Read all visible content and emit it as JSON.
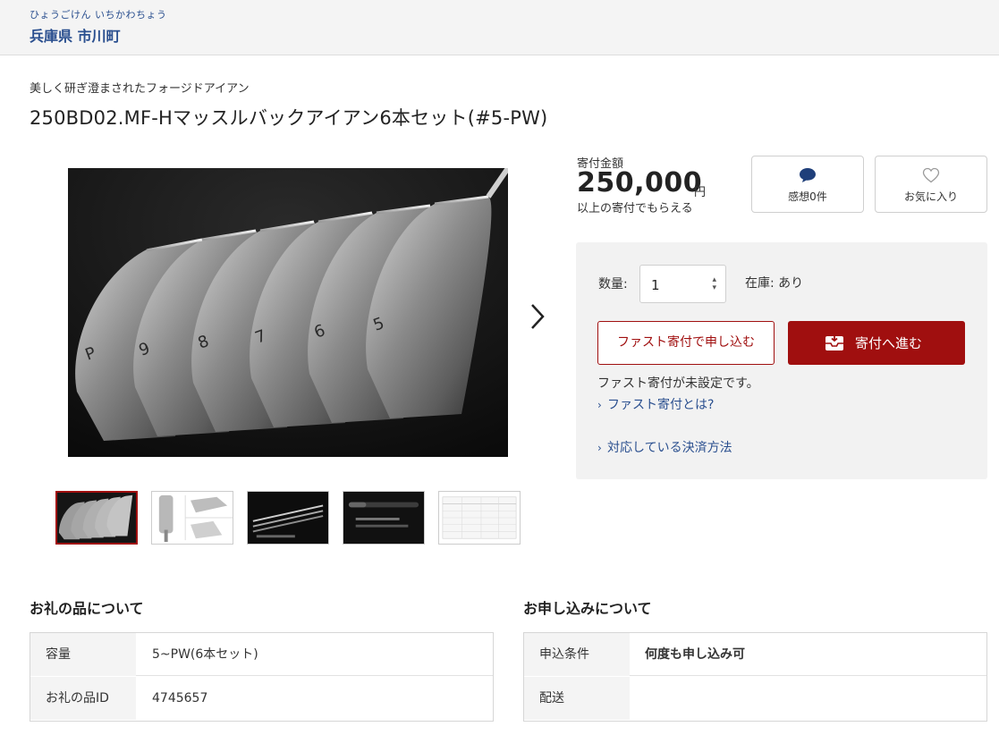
{
  "header": {
    "municipality_kana": "ひょうごけん いちかわちょう",
    "municipality": "兵庫県 市川町"
  },
  "product": {
    "catch_copy": "美しく研ぎ澄まされたフォージドアイアン",
    "title": "250BD02.MF-Hマッスルバックアイアン6本セット(#5-PW)",
    "main_image_numbers": [
      "P",
      "9",
      "8",
      "7",
      "6",
      "5"
    ]
  },
  "donation": {
    "amount_label": "寄付金額",
    "amount": "250,000",
    "unit": "円",
    "note": "以上の寄付でもらえる",
    "review_label": "感想0件",
    "favorite_label": "お気に入り"
  },
  "purchase": {
    "qty_label": "数量:",
    "qty_value": "1",
    "stock_label": "在庫: あり",
    "fast_button": "ファスト寄付で申し込む",
    "donate_button": "寄付へ進む",
    "fast_note": "ファスト寄付が未設定です。",
    "fast_link": "ファスト寄付とは?",
    "payment_link": "対応している決済方法"
  },
  "gift_info": {
    "title": "お礼の品について",
    "rows": [
      {
        "label": "容量",
        "value": "5~PW(6本セット)"
      },
      {
        "label": "お礼の品ID",
        "value": "4745657"
      }
    ]
  },
  "apply_info": {
    "title": "お申し込みについて",
    "rows": [
      {
        "label": "申込条件",
        "value": "何度も申し込み可"
      },
      {
        "label": "配送",
        "value": ""
      }
    ]
  },
  "colors": {
    "accent": "#a00f0f",
    "link": "#2a4f8f",
    "panel": "#f2f2f2"
  },
  "icons": {
    "review": "speech-bubble-icon",
    "favorite": "heart-icon",
    "donate": "inbox-icon",
    "next": "chevron-right-icon"
  }
}
